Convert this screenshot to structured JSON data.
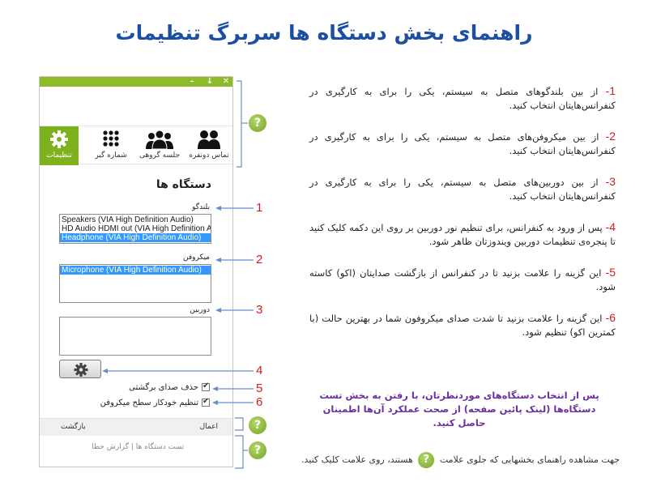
{
  "page_title": "راهنمای بخش دستگاه ها سربرگ تنظیمات",
  "window": {
    "controls": [
      "–",
      "↓",
      "✕"
    ],
    "nav": [
      {
        "label": "تماس دونفره",
        "icon": "two-person-icon"
      },
      {
        "label": "جلسه گروهی",
        "icon": "group-icon"
      },
      {
        "label": "شماره گیر",
        "icon": "dialpad-icon"
      },
      {
        "label": "تنظیمات",
        "icon": "gear-icon",
        "active": true
      }
    ],
    "section_title": "دستگاه ها",
    "speakers_label": "بلندگو",
    "speakers_options": [
      "Speakers (VIA High Definition Audio)",
      "HD Audio HDMI out (VIA High Definition A",
      "Headphone (VIA High Definition Audio)"
    ],
    "speakers_selected_index": 2,
    "mic_label": "میکروفن",
    "mic_options": [
      "Microphone (VIA High Definition Audio)"
    ],
    "mic_selected_index": 0,
    "camera_label": "دوربین",
    "camera_options": [],
    "echo_cancel_label": "حذف صدای برگشتی",
    "echo_cancel_checked": true,
    "auto_mic_label": "تنظیم خودکار سطح میکروفن",
    "auto_mic_checked": true,
    "apply_label": "اعمال",
    "back_label": "بازگشت",
    "test_link": "تست دستگاه ها",
    "separator": "|",
    "report_link": "گزارش خطا"
  },
  "annotations": {
    "numbers": [
      "1",
      "2",
      "3",
      "4",
      "5",
      "6"
    ],
    "help_badge": "?"
  },
  "instructions": [
    {
      "num": "1-",
      "text": " از بین بلندگوهای متصل به سیستم، یکی را برای به کارگیری در کنفرانس‌هایتان انتخاب کنید."
    },
    {
      "num": "2-",
      "text": " از بین میکروفن‌های متصل به سیستم، یکی را  برای به کارگیری در کنفرانس‌هایتان انتخاب کنید."
    },
    {
      "num": "3-",
      "text": " از بین دوربین‌های متصل به سیستم، یکی را  برای به کارگیری در کنفرانس‌هایتان انتخاب کنید."
    },
    {
      "num": "4-",
      "text": " پس از ورود به کنفرانس، برای تنظیم نور دوربین بر روی این دکمه کلیک کنید تا پنجره‌ی تنظیمات دوربین ویندوزتان ظاهر شود."
    },
    {
      "num": "5-",
      "text": " این گزینه را علامت بزنید تا در کنفرانس از بازگشت صدایتان (اکو) کاسته شود."
    },
    {
      "num": "6-",
      "text": " این گزینه را علامت بزنید تا شدت صدای میکروفون شما در بهترین حالت (با کمترین اکو) تنظیم شود."
    }
  ],
  "note": "پس از انتخاب دستگاه‌های موردنظرتان، با رفتن به بخش تست دستگاه‌ها (لینک پائین صفحه) از صحت عملکرد آن‌ها اطمینان حاصل کنید.",
  "bottom_text_before": "جهت مشاهده راهنمای بخشهایی که جلوی علامت",
  "bottom_text_after": "هستند، روی علامت کلیک کنید.",
  "colors": {
    "accent_green": "#7db11d",
    "title_blue": "#1c4fa3",
    "number_red": "#d41c1c",
    "note_purple": "#6a2fa0",
    "selection_blue": "#3399ff"
  }
}
